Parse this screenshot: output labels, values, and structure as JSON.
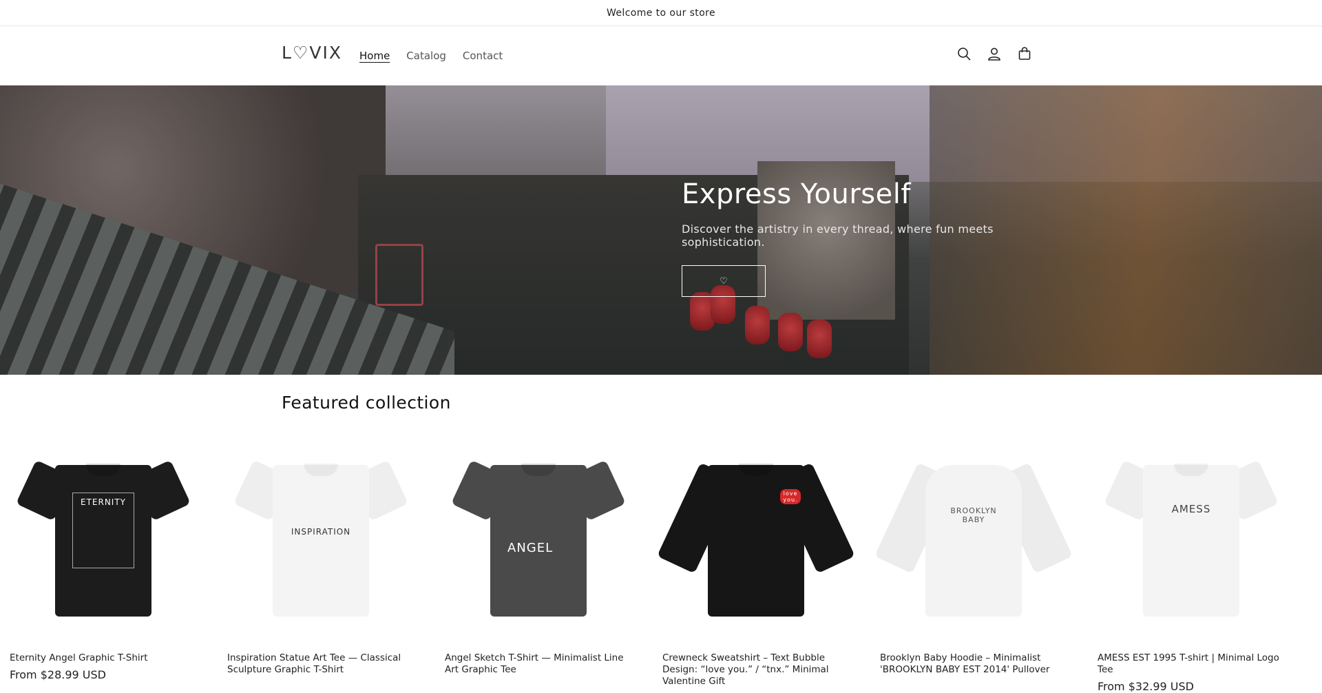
{
  "announcement": {
    "text": "Welcome to our store"
  },
  "header": {
    "logo": "L♡VIX",
    "nav": [
      {
        "label": "Home",
        "active": true
      },
      {
        "label": "Catalog",
        "active": false
      },
      {
        "label": "Contact",
        "active": false
      }
    ],
    "icons": [
      "search-icon",
      "account-icon",
      "cart-icon"
    ]
  },
  "hero": {
    "title": "Express Yourself",
    "subtitle": "Discover the artistry in every thread, where fun meets sophistication.",
    "button_label": "♡"
  },
  "featured": {
    "title": "Featured collection",
    "products": [
      {
        "title": "Eternity Angel Graphic T-Shirt",
        "price": "From $28.99 USD",
        "color": "#1c1c1c",
        "print_text": "ETERNITY"
      },
      {
        "title": "Inspiration Statue Art Tee — Classical Sculpture Graphic T-Shirt",
        "price": "",
        "color": "#f4f4f4",
        "print_text": "INSPIRATION"
      },
      {
        "title": "Angel Sketch T-Shirt — Minimalist Line Art Graphic Tee",
        "price": "",
        "color": "#4a4a4a",
        "print_text": "ANGEL"
      },
      {
        "title": "Crewneck Sweatshirt – Text Bubble Design: “love you.” / “tnx.” Minimal Valentine Gift",
        "price": "",
        "color": "#161616",
        "print_text": "love you."
      },
      {
        "title": "Brooklyn Baby Hoodie – Minimalist 'BROOKLYN BABY EST 2014' Pullover",
        "price": "",
        "color": "#f3f3f3",
        "print_text": "BROOKLYN BABY"
      },
      {
        "title": "AMESS EST 1995 T-shirt | Minimal Logo Tee",
        "price": "From $32.99 USD",
        "color": "#f4f4f4",
        "print_text": "AMESS"
      }
    ]
  }
}
